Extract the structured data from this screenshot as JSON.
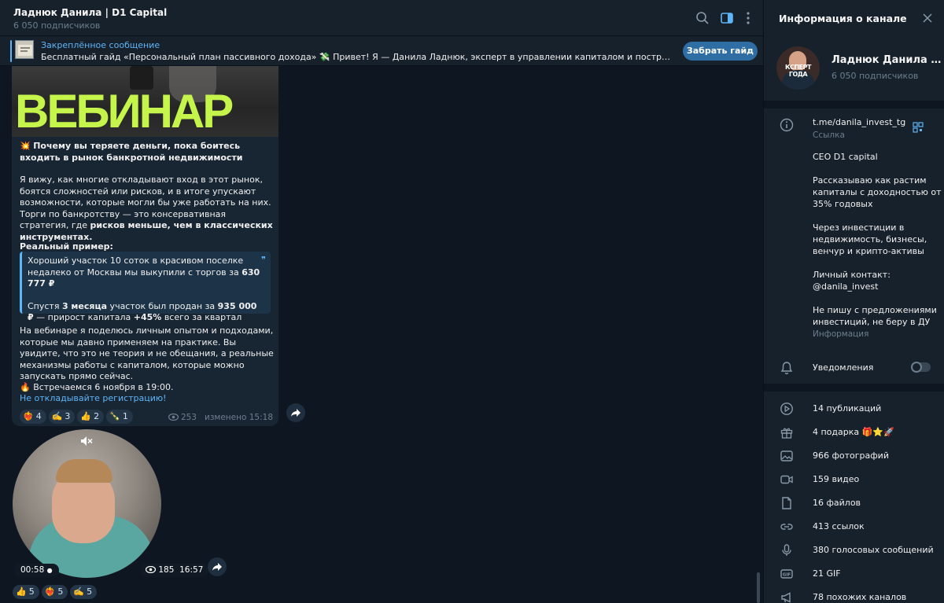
{
  "header": {
    "title": "Ладнюк Данила | D1 Capital",
    "subscribers": "6 050 подписчиков"
  },
  "pinned": {
    "title": "Закреплённое сообщение",
    "text": "Бесплатный гайд «Персональный план пассивного дохода» 💸 Привет! Я — Данила Ладнюк, эксперт в управлении капиталом и построении инвестиционных стр...",
    "button": "Забрать гайд"
  },
  "post": {
    "banner_word": "ВЕБИНАР",
    "headline_icon": "💥",
    "headline": "Почему вы теряете деньги, пока боитесь входить в рынок банкротной недвижимости",
    "para1_a": "Я вижу, как многие откладывают вход в этот рынок, боятся сложностей или рисков, и в итоге упускают возможности, которые могли бы уже работать на них. Торги по банкротству — это консервативная стратегия, где ",
    "para1_b": "рисков меньше, чем в классических инструментах.",
    "example_title": "Реальный пример:",
    "quote_a": "Хороший участок 10 соток в красивом поселке недалеко от Москвы мы выкупили с торгов за ",
    "quote_price1": "630 777 ₽",
    "quote_b1": "Спустя ",
    "quote_period": "3 месяца",
    "quote_b2": " участок был продан за ",
    "quote_price2": "935 000 ₽",
    "quote_b3": " — прирост капитала ",
    "quote_growth": "+45%",
    "quote_b4": " всего за квартал",
    "para2": "На вебинаре я поделюсь личным опытом и подходами, которые мы давно применяем на практике. Вы увидите, что это не теория и не обещания, а реальные механизмы работы с капиталом, которые можно запускать прямо сейчас.",
    "meet": "🔥 Встречаемся 6 ноября в 19:00.",
    "link": "Не откладывайте регистрацию!",
    "reactions": [
      {
        "emoji": "❤️‍🔥",
        "count": "4"
      },
      {
        "emoji": "✍️",
        "count": "3"
      },
      {
        "emoji": "👍",
        "count": "2"
      },
      {
        "emoji": "🍾",
        "count": "1"
      }
    ],
    "views": "253",
    "edited": "изменено 15:18"
  },
  "video": {
    "duration": "00:58",
    "views": "185",
    "time": "16:57",
    "reactions": [
      {
        "emoji": "👍",
        "count": "5"
      },
      {
        "emoji": "❤️‍🔥",
        "count": "5"
      },
      {
        "emoji": "✍️",
        "count": "5"
      }
    ]
  },
  "panel": {
    "title": "Информация о канале",
    "avatar_text": "КСПЕРТ ГОДА",
    "name": "Ладнюк Данила | D1 Capital",
    "subscribers": "6 050 подписчиков",
    "link": "t.me/danila_invest_tg",
    "link_label": "Ссылка",
    "about": [
      "CEO D1 capital",
      "Рассказываю как растим капиталы с доходностью от 35% годовых",
      "Через инвестиции в недвижимость, бизнесы, венчур и крипто-активы",
      "Личный контакт:"
    ],
    "contact": "@danila_invest",
    "about_last": "Не пишу с предложениями инвестиций, не беру в ДУ",
    "about_label": "Информация",
    "notifications": "Уведомления",
    "stats": [
      {
        "icon": "publications-icon",
        "label": "14 публикаций"
      },
      {
        "icon": "gift-icon",
        "label": "4 подарка 🎁⭐🚀"
      },
      {
        "icon": "photo-icon",
        "label": "966 фотографий"
      },
      {
        "icon": "video-icon",
        "label": "159 видео"
      },
      {
        "icon": "file-icon",
        "label": "16 файлов"
      },
      {
        "icon": "link-icon",
        "label": "413 ссылок"
      },
      {
        "icon": "mic-icon",
        "label": "380 голосовых сообщений"
      },
      {
        "icon": "gif-icon",
        "label": "21 GIF"
      },
      {
        "icon": "megaphone-icon",
        "label": "78 похожих каналов"
      }
    ]
  },
  "colors": {
    "accent": "#5eb5f7",
    "bubble": "#182533",
    "panel": "#17212b",
    "background": "#0e1621",
    "banner_text": "#c5f54a"
  }
}
